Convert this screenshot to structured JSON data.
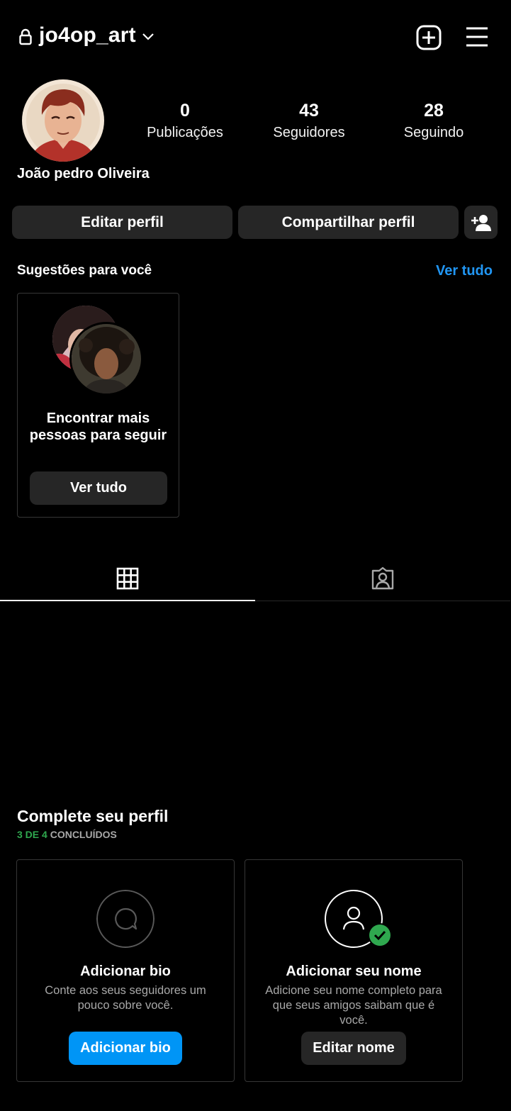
{
  "header": {
    "username": "jo4op_art",
    "icons": [
      "lock-icon",
      "chevron-down-icon",
      "plus-square-icon",
      "hamburger-menu-icon"
    ]
  },
  "profile": {
    "full_name": "João pedro Oliveira",
    "stats": [
      {
        "value": "0",
        "label": "Publicações"
      },
      {
        "value": "43",
        "label": "Seguidores"
      },
      {
        "value": "28",
        "label": "Seguindo"
      }
    ],
    "edit_button": "Editar perfil",
    "share_button": "Compartilhar perfil"
  },
  "suggestions": {
    "title": "Sugestões para você",
    "see_all": "Ver tudo",
    "card_text": "Encontrar mais pessoas para seguir",
    "card_button": "Ver tudo"
  },
  "tabs": [
    {
      "icon": "grid-icon",
      "active": true
    },
    {
      "icon": "tagged-person-icon",
      "active": false
    }
  ],
  "complete_profile": {
    "title": "Complete seu perfil",
    "progress_count": "3 DE 4",
    "progress_label": "CONCLUÍDOS",
    "cards": [
      {
        "icon": "speech-bubble-icon",
        "title": "Adicionar bio",
        "description": "Conte aos seus seguidores um pouco sobre você.",
        "button": "Adicionar bio"
      },
      {
        "icon": "person-check-icon",
        "title": "Adicionar seu nome",
        "description": "Adicione seu nome completo para que seus amigos saibam que é você.",
        "button": "Editar nome"
      }
    ]
  },
  "colors": {
    "background": "#000000",
    "button_gray": "#262626",
    "accent_blue": "#0095f6",
    "link_blue": "#2196f3",
    "success_green": "#2fa84f",
    "muted_text": "#a8a8a8"
  }
}
